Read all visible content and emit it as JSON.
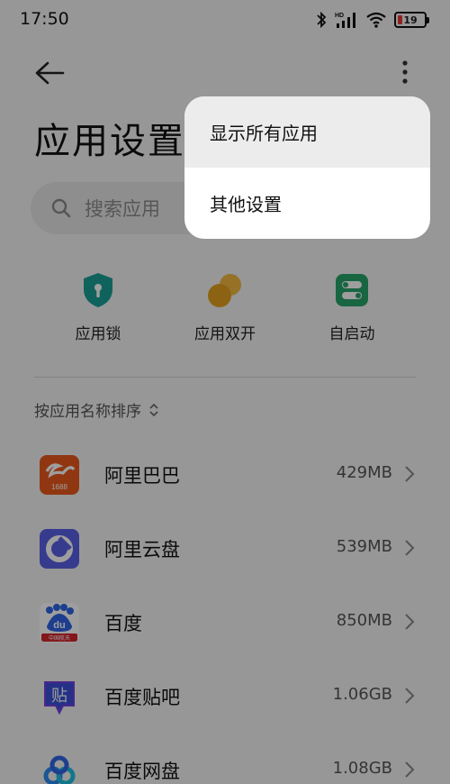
{
  "status_bar": {
    "time": "17:50",
    "battery_level": "19",
    "hd_label": "HD"
  },
  "header": {
    "title": "应用设置"
  },
  "search": {
    "placeholder": "搜索应用"
  },
  "quick_actions": [
    {
      "label": "应用锁",
      "icon": "shield-lock-icon",
      "color": "#1aa197"
    },
    {
      "label": "应用双开",
      "icon": "dual-app-icon",
      "color": "#e2a11f"
    },
    {
      "label": "自启动",
      "icon": "autostart-toggle-icon",
      "color": "#27a46b"
    }
  ],
  "sort": {
    "label": "按应用名称排序"
  },
  "apps": [
    {
      "name": "阿里巴巴",
      "size": "429MB",
      "icon": "alibaba-1688-icon",
      "badge": "1688"
    },
    {
      "name": "阿里云盘",
      "size": "539MB",
      "icon": "aliyun-drive-icon"
    },
    {
      "name": "百度",
      "size": "850MB",
      "icon": "baidu-icon",
      "badge": "中国航天"
    },
    {
      "name": "百度贴吧",
      "size": "1.06GB",
      "icon": "baidu-tieba-icon",
      "glyph": "贴"
    },
    {
      "name": "百度网盘",
      "size": "1.08GB",
      "icon": "baidu-netdisk-icon"
    }
  ],
  "menu": {
    "items": [
      {
        "label": "显示所有应用"
      },
      {
        "label": "其他设置"
      }
    ]
  }
}
